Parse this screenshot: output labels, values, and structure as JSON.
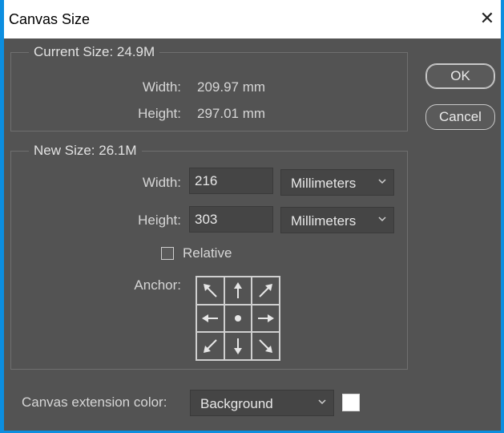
{
  "window": {
    "title": "Canvas Size",
    "close_label": "✕"
  },
  "current_size": {
    "title": "Current Size: 24.9M",
    "width_label": "Width:",
    "width_value": "209.97 mm",
    "height_label": "Height:",
    "height_value": "297.01 mm"
  },
  "new_size": {
    "title": "New Size: 26.1M",
    "width_label": "Width:",
    "width_value": "216",
    "width_unit": "Millimeters",
    "height_label": "Height:",
    "height_value": "303",
    "height_unit": "Millimeters",
    "relative_label": "Relative",
    "relative_checked": false,
    "anchor_label": "Anchor:",
    "anchor_cells": [
      "arrow-up-left-icon",
      "arrow-up-icon",
      "arrow-up-right-icon",
      "arrow-left-icon",
      "anchor-center-dot-icon",
      "arrow-right-icon",
      "arrow-down-left-icon",
      "arrow-down-icon",
      "arrow-down-right-icon"
    ]
  },
  "extension": {
    "label": "Canvas extension color:",
    "value": "Background",
    "swatch_color": "#ffffff"
  },
  "buttons": {
    "ok": "OK",
    "cancel": "Cancel"
  },
  "colors": {
    "dialog_bg": "#535353",
    "frame": "#0c8ee0",
    "field_bg": "#454545"
  }
}
